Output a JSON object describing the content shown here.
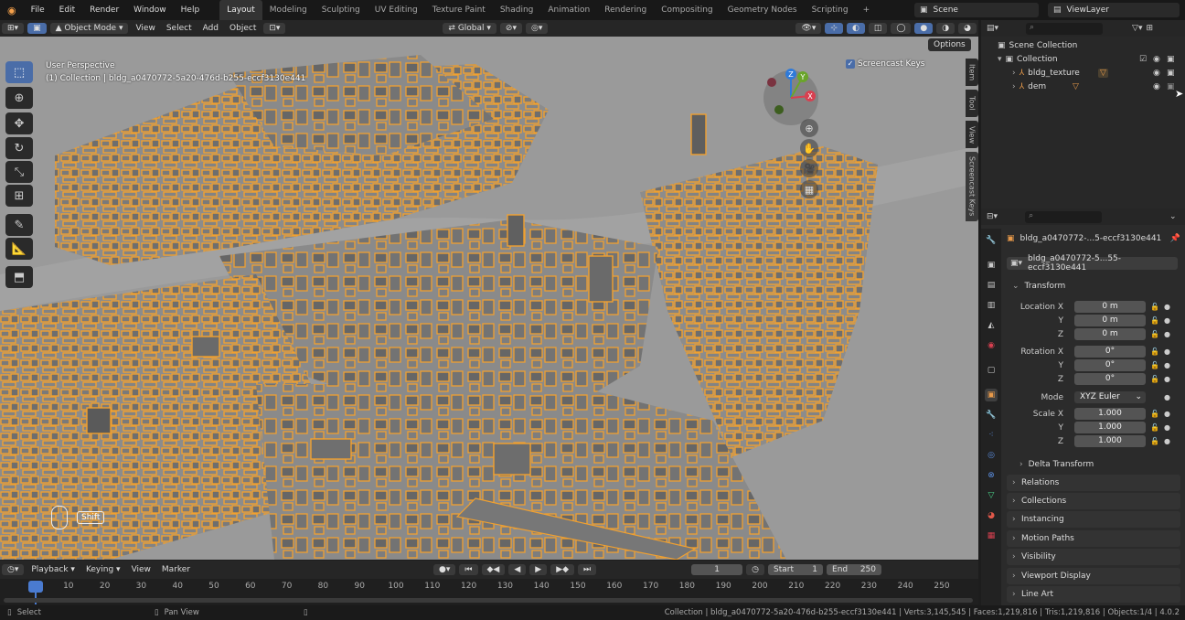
{
  "topbar": {
    "menus": [
      "File",
      "Edit",
      "Render",
      "Window",
      "Help"
    ],
    "workspaces": [
      "Layout",
      "Modeling",
      "Sculpting",
      "UV Editing",
      "Texture Paint",
      "Shading",
      "Animation",
      "Rendering",
      "Compositing",
      "Geometry Nodes",
      "Scripting"
    ],
    "active_workspace": "Layout",
    "scene": "Scene",
    "view_layer": "ViewLayer"
  },
  "viewport_header": {
    "mode": "Object Mode",
    "menus": [
      "View",
      "Select",
      "Add",
      "Object"
    ],
    "orientation": "Global",
    "options": "Options"
  },
  "viewport": {
    "perspective": "User Perspective",
    "selection": "(1) Collection | bldg_a0470772-5a20-476d-b255-eccf3130e441",
    "screencast_toggle": "Screencast Keys",
    "key_hint": "Shift",
    "side_tabs": [
      "Item",
      "Tool",
      "View",
      "Screencast Keys"
    ],
    "gizmo_axes": [
      "Z",
      "Y",
      "X"
    ]
  },
  "outliner": {
    "scene_collection": "Scene Collection",
    "collection": "Collection",
    "items": [
      "bldg_texture",
      "dem"
    ]
  },
  "properties": {
    "object_name": "bldg_a0470772-...5-eccf3130e441",
    "data_name": "bldg_a0470772-5...55-eccf3130e441",
    "transform_title": "Transform",
    "location": {
      "label": "Location X",
      "x": "0 m",
      "y": "0 m",
      "z": "0 m"
    },
    "rotation": {
      "label": "Rotation X",
      "x": "0°",
      "y": "0°",
      "z": "0°"
    },
    "mode_label": "Mode",
    "mode_value": "XYZ Euler",
    "scale": {
      "label": "Scale X",
      "x": "1.000",
      "y": "1.000",
      "z": "1.000"
    },
    "axis_y": "Y",
    "axis_z": "Z",
    "delta_transform": "Delta Transform",
    "sections": [
      "Relations",
      "Collections",
      "Instancing",
      "Motion Paths",
      "Visibility",
      "Viewport Display",
      "Line Art"
    ]
  },
  "timeline": {
    "menus": [
      "Playback",
      "Keying",
      "View",
      "Marker"
    ],
    "current_frame": "1",
    "start_label": "Start",
    "start": "1",
    "end_label": "End",
    "end": "250",
    "ticks": [
      "1",
      "10",
      "20",
      "30",
      "40",
      "50",
      "60",
      "70",
      "80",
      "90",
      "100",
      "110",
      "120",
      "130",
      "140",
      "150",
      "160",
      "170",
      "180",
      "190",
      "200",
      "210",
      "220",
      "230",
      "240",
      "250"
    ]
  },
  "statusbar": {
    "select": "Select",
    "pan": "Pan View",
    "info": "Collection | bldg_a0470772-5a20-476d-b255-eccf3130e441 | Verts:3,145,545 | Faces:1,219,816 | Tris:1,219,816 | Objects:1/4 | 4.0.2"
  },
  "colors": {
    "accent_blue": "#4a6da8",
    "selection_orange": "#f0a030",
    "building_gray": "#8f8f8f"
  }
}
